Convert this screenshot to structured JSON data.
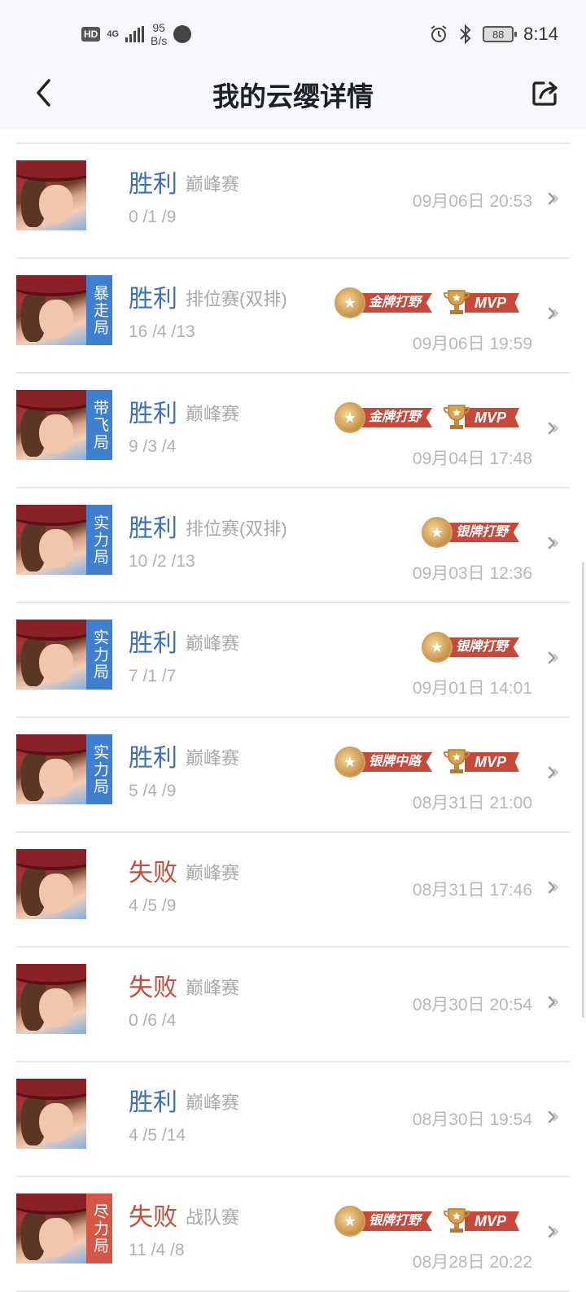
{
  "status_bar": {
    "hd": "HD",
    "network": "4G",
    "speed_value": "95",
    "speed_unit": "B/s",
    "battery": "88",
    "time": "8:14"
  },
  "nav": {
    "title": "我的云缨详情"
  },
  "colors": {
    "win": "#3d70b8",
    "loss": "#cc4b3c",
    "tag_blue": "#3f7fd0",
    "tag_red": "#d55745",
    "ribbon": "#c8483a"
  },
  "matches": [
    {
      "result": "胜利",
      "outcome": "win",
      "mode": "巅峰赛",
      "kda": "0 /1 /9",
      "date": "09月06日 20:53",
      "tag": "",
      "tag_color": "",
      "badges": []
    },
    {
      "result": "胜利",
      "outcome": "win",
      "mode": "排位赛(双排)",
      "kda": "16 /4 /13",
      "date": "09月06日 19:59",
      "tag": "暴走局",
      "tag_color": "blue",
      "badges": [
        {
          "label": "金牌打野",
          "kind": "medal"
        },
        {
          "label": "MVP",
          "kind": "mvp"
        }
      ]
    },
    {
      "result": "胜利",
      "outcome": "win",
      "mode": "巅峰赛",
      "kda": "9 /3 /4",
      "date": "09月04日 17:48",
      "tag": "带飞局",
      "tag_color": "blue",
      "badges": [
        {
          "label": "金牌打野",
          "kind": "medal"
        },
        {
          "label": "MVP",
          "kind": "mvp"
        }
      ]
    },
    {
      "result": "胜利",
      "outcome": "win",
      "mode": "排位赛(双排)",
      "kda": "10 /2 /13",
      "date": "09月03日 12:36",
      "tag": "实力局",
      "tag_color": "blue",
      "badges": [
        {
          "label": "银牌打野",
          "kind": "medal"
        }
      ]
    },
    {
      "result": "胜利",
      "outcome": "win",
      "mode": "巅峰赛",
      "kda": "7 /1 /7",
      "date": "09月01日 14:01",
      "tag": "实力局",
      "tag_color": "blue",
      "badges": [
        {
          "label": "银牌打野",
          "kind": "medal"
        }
      ]
    },
    {
      "result": "胜利",
      "outcome": "win",
      "mode": "巅峰赛",
      "kda": "5 /4 /9",
      "date": "08月31日 21:00",
      "tag": "实力局",
      "tag_color": "blue",
      "badges": [
        {
          "label": "银牌中路",
          "kind": "medal"
        },
        {
          "label": "MVP",
          "kind": "mvp"
        }
      ]
    },
    {
      "result": "失败",
      "outcome": "loss",
      "mode": "巅峰赛",
      "kda": "4 /5 /9",
      "date": "08月31日 17:46",
      "tag": "",
      "tag_color": "",
      "badges": []
    },
    {
      "result": "失败",
      "outcome": "loss",
      "mode": "巅峰赛",
      "kda": "0 /6 /4",
      "date": "08月30日 20:54",
      "tag": "",
      "tag_color": "",
      "badges": []
    },
    {
      "result": "胜利",
      "outcome": "win",
      "mode": "巅峰赛",
      "kda": "4 /5 /14",
      "date": "08月30日 19:54",
      "tag": "",
      "tag_color": "",
      "badges": []
    },
    {
      "result": "失败",
      "outcome": "loss",
      "mode": "战队赛",
      "kda": "11 /4 /8",
      "date": "08月28日 20:22",
      "tag": "尽力局",
      "tag_color": "red",
      "badges": [
        {
          "label": "银牌打野",
          "kind": "medal"
        },
        {
          "label": "MVP",
          "kind": "mvp"
        }
      ]
    }
  ]
}
